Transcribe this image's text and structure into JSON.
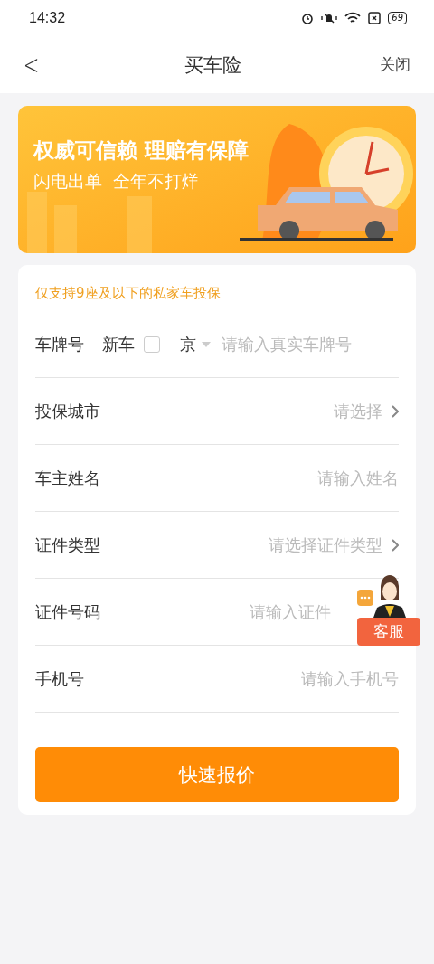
{
  "status_bar": {
    "time": "14:32",
    "battery": "69"
  },
  "nav": {
    "back": "<",
    "title": "买车险",
    "close": "关闭"
  },
  "banner": {
    "headline": "权威可信赖 理赔有保障",
    "subline": "闪电出单  全年不打烊",
    "kind": "picture"
  },
  "form": {
    "notice": "仅支持9座及以下的私家车投保",
    "rows": [
      {
        "kind": "plate",
        "label": "车牌号",
        "new_car_label": "新车",
        "new_car_checked": false,
        "province": "京",
        "placeholder": "请输入真实车牌号"
      },
      {
        "kind": "select",
        "label": "投保城市",
        "placeholder": "请选择"
      },
      {
        "kind": "input",
        "label": "车主姓名",
        "placeholder": "请输入姓名"
      },
      {
        "kind": "select",
        "label": "证件类型",
        "placeholder": "请选择证件类型"
      },
      {
        "kind": "input",
        "label": "证件号码",
        "placeholder": "请输入证件"
      },
      {
        "kind": "input",
        "label": "手机号",
        "placeholder": "请输入手机号"
      }
    ],
    "submit": "快速报价"
  },
  "support": {
    "label": "客服"
  }
}
